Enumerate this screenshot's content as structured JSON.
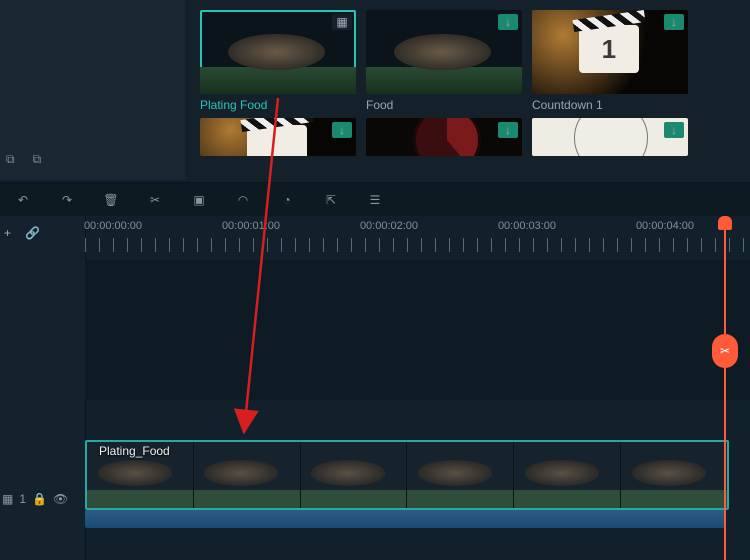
{
  "media": {
    "items": [
      {
        "label": "Plating Food",
        "selected": true,
        "badge": "clip"
      },
      {
        "label": "Food",
        "selected": false,
        "badge": "download"
      },
      {
        "label": "Countdown 1",
        "selected": false,
        "badge": "download",
        "num": "1"
      }
    ],
    "row2_badges": [
      "download",
      "download",
      "download"
    ]
  },
  "timeline": {
    "marks": [
      "00:00:00:00",
      "00:00:01:00",
      "00:00:02:00",
      "00:00:03:00",
      "00:00:04:00"
    ],
    "clip_label": "Plating_Food",
    "track_number": "1"
  },
  "icons": {
    "new_folder": "⧉",
    "open_folder": "⧉",
    "undo": "↶",
    "redo": "↷",
    "delete": "🗑",
    "cut_tool": "✂",
    "crop": "▣",
    "speed": "◠",
    "color": "◔",
    "export": "⇱",
    "settings": "☰",
    "add_track": "+",
    "link": "🔗",
    "clip_badge": "▦",
    "dl_badge": "↓",
    "lock": "🔒",
    "eye": "👁",
    "scissors": "✂"
  }
}
